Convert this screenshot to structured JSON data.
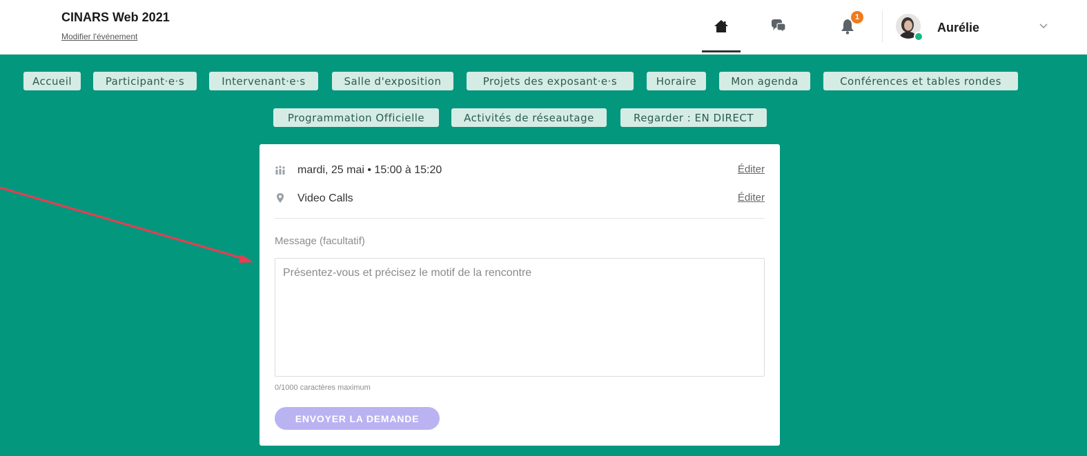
{
  "header": {
    "event_title": "CINARS Web 2021",
    "edit_event_link": "Modifier l'événement",
    "notification_count": "1",
    "user_name": "Aurélie"
  },
  "tabs": [
    "Accueil",
    "Participant·e·s",
    "Intervenant·e·s",
    "Salle d'exposition",
    "Projets des exposant·e·s",
    "Horaire",
    "Mon agenda",
    "Conférences et tables rondes",
    "Programmation Officielle",
    "Activités de réseautage",
    "Regarder : EN DIRECT"
  ],
  "form": {
    "date_text": "mardi, 25 mai • 15:00 à 15:20",
    "location_text": "Video Calls",
    "edit_label": "Éditer",
    "message_label": "Message (facultatif)",
    "message_placeholder": "Présentez-vous et précisez le motif de la rencontre",
    "char_counter": "0/1000 caractères maximum",
    "send_button": "ENVOYER LA DEMANDE"
  },
  "colors": {
    "background_green": "#03977e",
    "tab_bg": "#d5ece4",
    "button_disabled": "#b9b3f2",
    "annotation_arrow": "#ec3b50",
    "badge": "#f07a1e"
  },
  "icons": {
    "home": "home-icon",
    "chat": "chat-bubbles-icon",
    "bell": "bell-icon",
    "date": "people-calendar-icon",
    "location": "map-pin-icon",
    "chevron": "chevron-down-icon"
  }
}
